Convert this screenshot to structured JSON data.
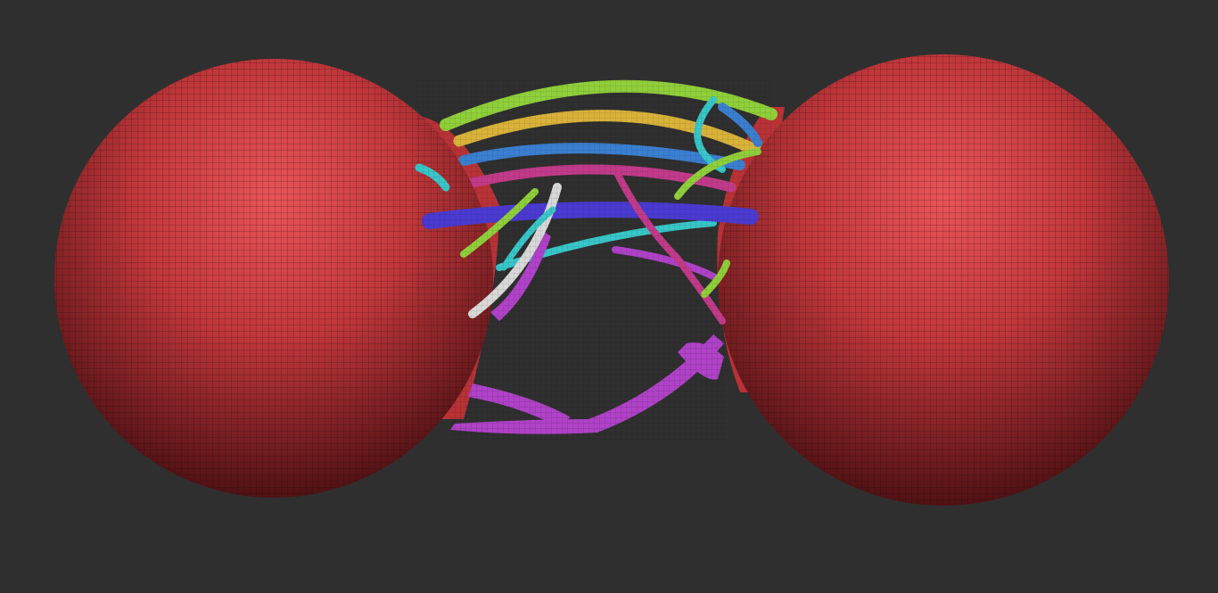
{
  "scene": {
    "background_color": "#2f2f2f",
    "sphere_color": "#c2373b",
    "sphere_highlight_color": "#e85458",
    "sphere_shadow_color": "#5a1215",
    "wire_color": "#1a0a0a",
    "strand_colors": {
      "green": "#8fcf3a",
      "yellow": "#d9b23a",
      "blue": "#3a7fd0",
      "cyan": "#38c6c8",
      "magenta": "#c23a8a",
      "purple": "#b042c8",
      "indigo": "#4a3ad0",
      "white": "#d8d8d8",
      "red": "#d0403c"
    }
  }
}
